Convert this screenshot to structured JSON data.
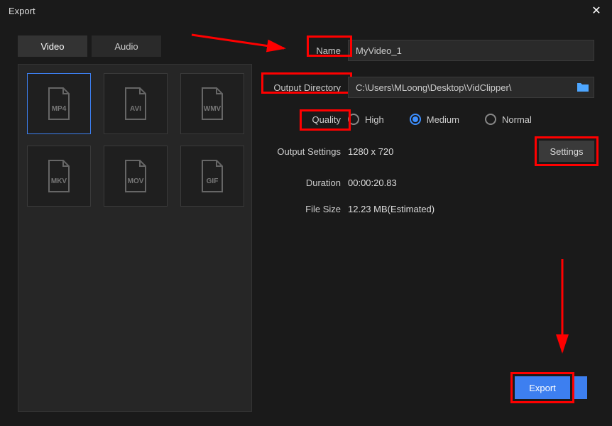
{
  "window": {
    "title": "Export"
  },
  "tabs": {
    "video": "Video",
    "audio": "Audio"
  },
  "formats": [
    "MP4",
    "AVI",
    "WMV",
    "MKV",
    "MOV",
    "GIF"
  ],
  "labels": {
    "name": "Name",
    "output_dir": "Output Directory",
    "quality": "Quality",
    "output_settings": "Output Settings",
    "duration": "Duration",
    "file_size": "File Size"
  },
  "fields": {
    "name_value": "MyVideo_1",
    "output_dir_value": "C:\\Users\\MLoong\\Desktop\\VidClipper\\",
    "output_settings_value": "1280 x 720",
    "duration_value": "00:00:20.83",
    "file_size_value": "12.23 MB(Estimated)"
  },
  "quality": {
    "options": {
      "high": "High",
      "medium": "Medium",
      "normal": "Normal"
    },
    "selected": "medium"
  },
  "buttons": {
    "settings": "Settings",
    "export": "Export"
  }
}
